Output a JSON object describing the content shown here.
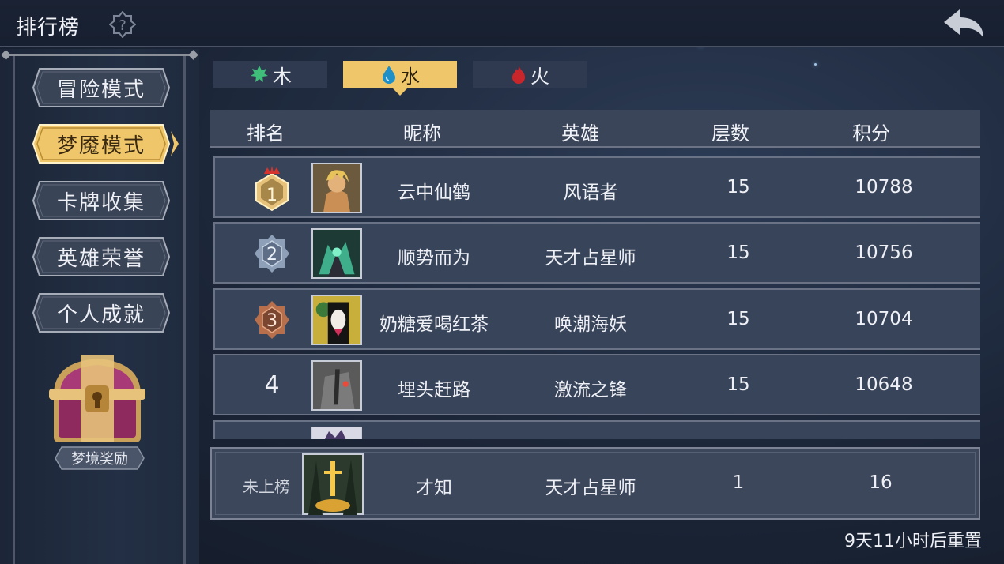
{
  "header": {
    "title": "排行榜"
  },
  "sidebar": {
    "items": [
      {
        "label": "冒险模式",
        "active": false
      },
      {
        "label": "梦魇模式",
        "active": true
      },
      {
        "label": "卡牌收集",
        "active": false
      },
      {
        "label": "英雄荣誉",
        "active": false
      },
      {
        "label": "个人成就",
        "active": false
      }
    ],
    "reward_label": "梦境奖励"
  },
  "element_tabs": [
    {
      "label": "木",
      "icon": "leaf-icon",
      "color": "#3fbf7a",
      "active": false
    },
    {
      "label": "水",
      "icon": "water-drop-icon",
      "color": "#1f8fc8",
      "active": true
    },
    {
      "label": "火",
      "icon": "fire-icon",
      "color": "#c9262b",
      "active": false
    }
  ],
  "table": {
    "headers": {
      "rank": "排名",
      "nickname": "昵称",
      "hero": "英雄",
      "floors": "层数",
      "score": "积分"
    },
    "rows": [
      {
        "rank": "1",
        "nickname": "云中仙鹤",
        "hero": "风语者",
        "floors": "15",
        "score": "10788"
      },
      {
        "rank": "2",
        "nickname": "顺势而为",
        "hero": "天才占星师",
        "floors": "15",
        "score": "10756"
      },
      {
        "rank": "3",
        "nickname": "奶糖爱喝红茶",
        "hero": "唤潮海妖",
        "floors": "15",
        "score": "10704"
      },
      {
        "rank": "4",
        "nickname": "埋头赶路",
        "hero": "激流之锋",
        "floors": "15",
        "score": "10648"
      }
    ],
    "my_row": {
      "rank": "未上榜",
      "nickname": "才知",
      "hero": "天才占星师",
      "floors": "1",
      "score": "16"
    }
  },
  "footer": {
    "reset_text": "9天11小时后重置"
  },
  "colors": {
    "accent_gold": "#efc66a",
    "panel": "#38445a",
    "bg": "#1b2537"
  }
}
